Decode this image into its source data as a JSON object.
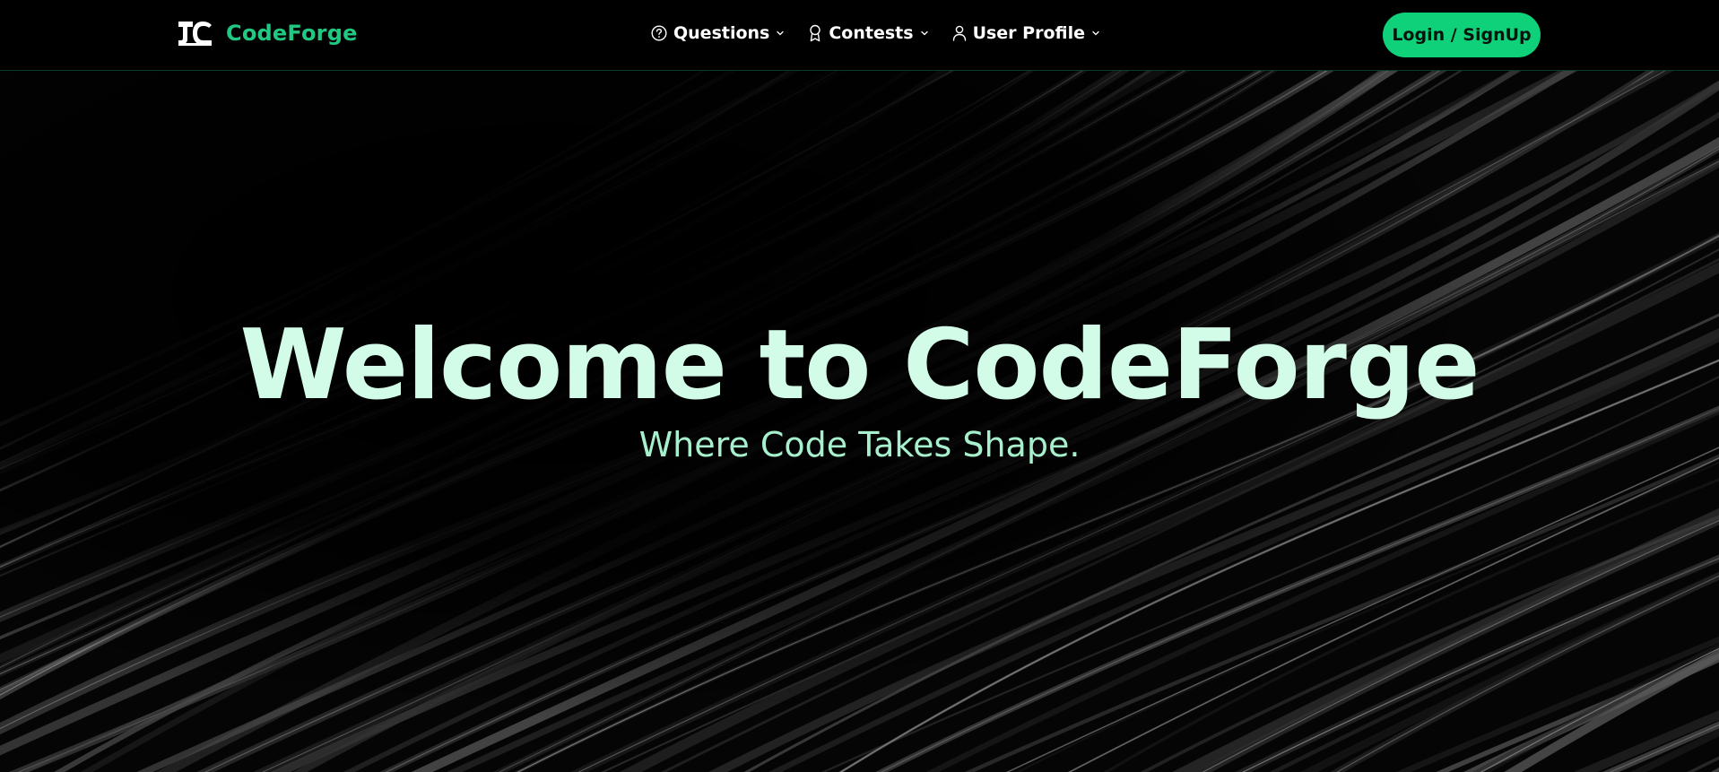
{
  "brand": {
    "name": "CodeForge",
    "logo_icon": "cf-logo-icon",
    "color": "#20c982"
  },
  "nav": {
    "items": [
      {
        "label": "Questions",
        "icon": "question-circle-icon"
      },
      {
        "label": "Contests",
        "icon": "award-ribbon-icon"
      },
      {
        "label": "User Profile",
        "icon": "user-icon"
      }
    ],
    "dropdown_icon": "chevron-down-icon"
  },
  "auth": {
    "login_label": "Login / SignUp",
    "button_color": "#0ed17a"
  },
  "hero": {
    "title": "Welcome to CodeForge",
    "subtitle": "Where Code Takes Shape.",
    "title_color": "#d2fbe8",
    "subtitle_color": "#a7f0cd"
  },
  "theme": {
    "background": "#030303",
    "accent": "#20c982"
  }
}
